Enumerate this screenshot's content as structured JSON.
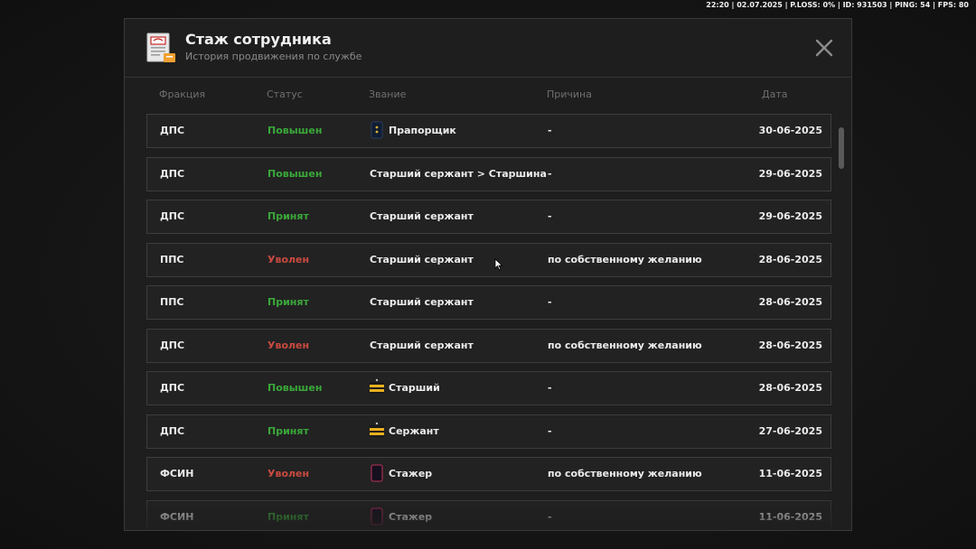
{
  "status_bar": {
    "text": "22:20 | 02.07.2025 | P.LOSS: 0% | ID: 931503 | PING: 54 | FPS: 80"
  },
  "header": {
    "icon": "document-stamp-icon",
    "title": "Стаж сотрудника",
    "subtitle": "История продвижения по службе",
    "close_icon": "close-icon"
  },
  "columns": {
    "faction": "Фракция",
    "status": "Статус",
    "rank": "Звание",
    "reason": "Причина",
    "date": "Дата"
  },
  "colors": {
    "promoted": "#3aa83a",
    "accepted": "#3aa83a",
    "fired": "#c84a40"
  },
  "rows": [
    {
      "faction": "ДПС",
      "status": "Повышен",
      "status_kind": "promoted",
      "rank_icon": "epaulet-praporshchik-icon",
      "rank": "Прапорщик",
      "reason": "-",
      "date": "30-06-2025"
    },
    {
      "faction": "ДПС",
      "status": "Повышен",
      "status_kind": "promoted",
      "rank_icon": "",
      "rank": "Старший сержант > Старшина",
      "reason": "-",
      "date": "29-06-2025"
    },
    {
      "faction": "ДПС",
      "status": "Принят",
      "status_kind": "accepted",
      "rank_icon": "",
      "rank": "Старший сержант",
      "reason": "-",
      "date": "29-06-2025"
    },
    {
      "faction": "ППС",
      "status": "Уволен",
      "status_kind": "fired",
      "rank_icon": "",
      "rank": "Старший сержант",
      "reason": "по собственному желанию",
      "date": "28-06-2025"
    },
    {
      "faction": "ППС",
      "status": "Принят",
      "status_kind": "accepted",
      "rank_icon": "",
      "rank": "Старший сержант",
      "reason": "-",
      "date": "28-06-2025"
    },
    {
      "faction": "ДПС",
      "status": "Уволен",
      "status_kind": "fired",
      "rank_icon": "",
      "rank": "Старший сержант",
      "reason": "по собственному желанию",
      "date": "28-06-2025"
    },
    {
      "faction": "ДПС",
      "status": "Повышен",
      "status_kind": "promoted",
      "rank_icon": "epaulet-gold-stripes-icon",
      "rank": "Старший",
      "reason": "-",
      "date": "28-06-2025"
    },
    {
      "faction": "ДПС",
      "status": "Принят",
      "status_kind": "accepted",
      "rank_icon": "epaulet-gold-stripes-icon",
      "rank": "Сержант",
      "reason": "-",
      "date": "27-06-2025"
    },
    {
      "faction": "ФСИН",
      "status": "Уволен",
      "status_kind": "fired",
      "rank_icon": "epaulet-plain-icon",
      "rank": "Стажер",
      "reason": "по собственному желанию",
      "date": "11-06-2025"
    },
    {
      "faction": "ФСИН",
      "status": "Принят",
      "status_kind": "accepted",
      "rank_icon": "epaulet-plain-icon",
      "rank": "Стажер",
      "reason": "-",
      "date": "11-06-2025"
    }
  ]
}
